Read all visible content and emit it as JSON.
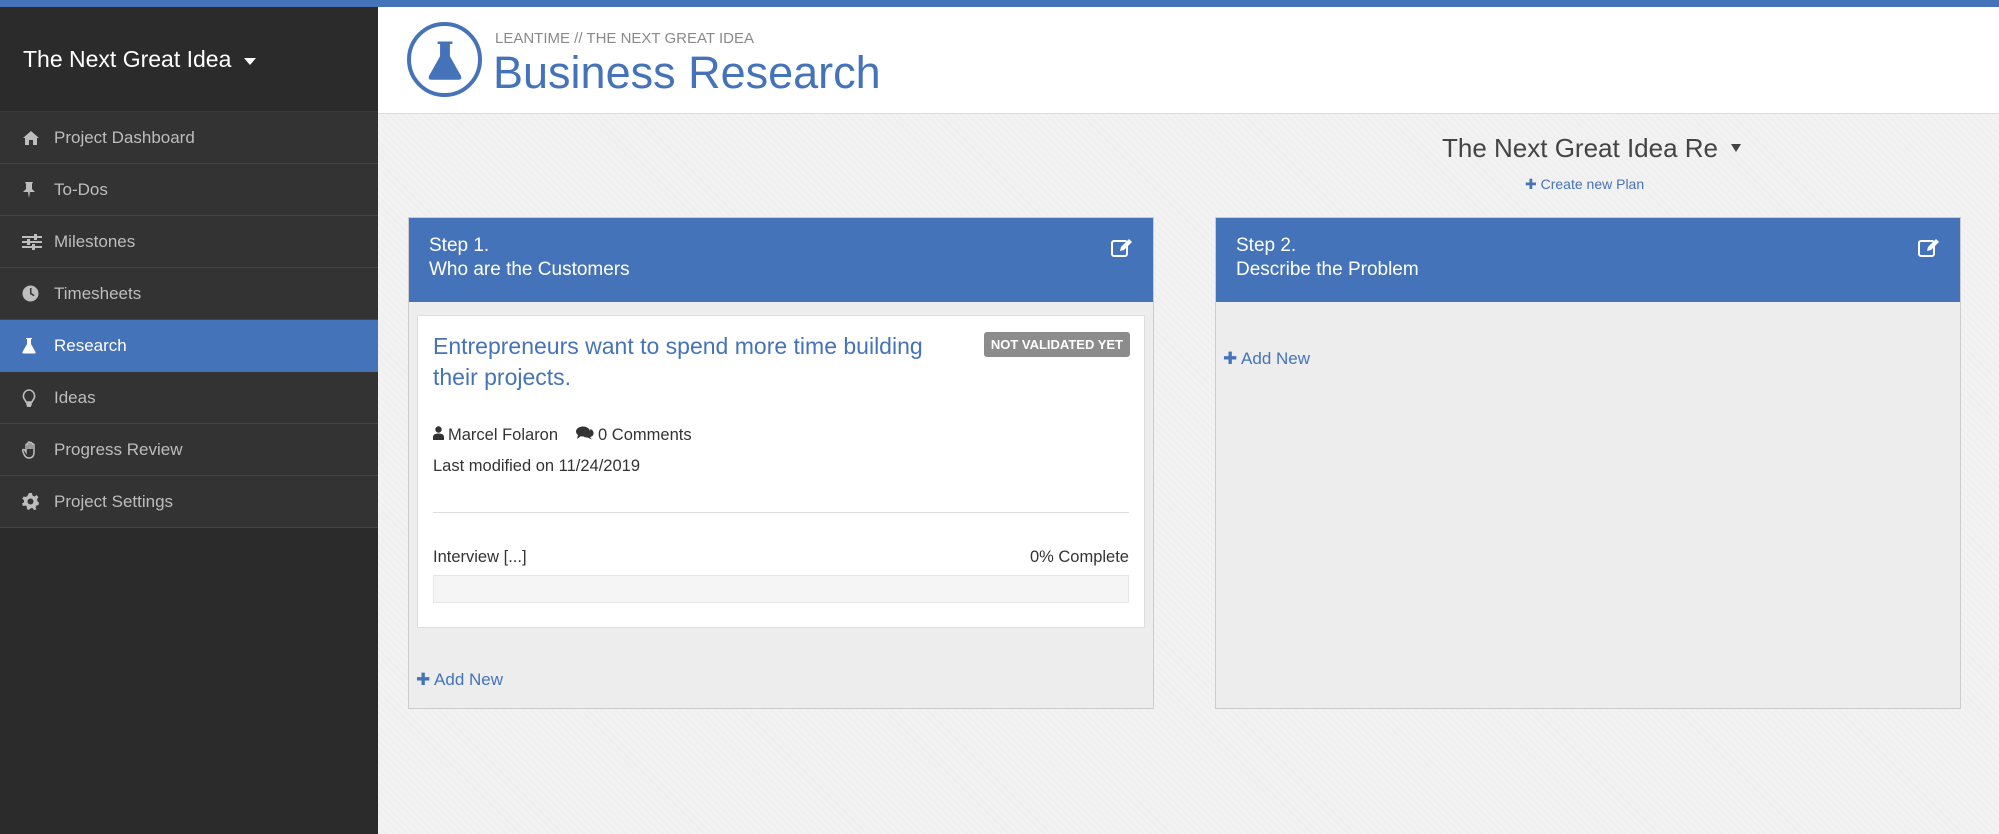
{
  "sidebar": {
    "project_name": "The Next Great Idea",
    "items": [
      {
        "label": "Project Dashboard",
        "icon": "home-icon"
      },
      {
        "label": "To-Dos",
        "icon": "pin-icon"
      },
      {
        "label": "Milestones",
        "icon": "sliders-icon"
      },
      {
        "label": "Timesheets",
        "icon": "clock-icon"
      },
      {
        "label": "Research",
        "icon": "flask-icon",
        "active": true
      },
      {
        "label": "Ideas",
        "icon": "lightbulb-icon"
      },
      {
        "label": "Progress Review",
        "icon": "hand-icon"
      },
      {
        "label": "Project Settings",
        "icon": "gear-icon"
      }
    ]
  },
  "header": {
    "breadcrumb": "LEANTIME // THE NEXT GREAT IDEA",
    "title": "Business Research",
    "icon": "flask-icon"
  },
  "plan": {
    "selected": "The Next Great Idea Re",
    "create_label": "Create new Plan"
  },
  "colors": {
    "accent": "#4573b9",
    "sidebar_bg": "#2b2b2b",
    "badge_bg": "#8c8c8c"
  },
  "steps": [
    {
      "title_line1": "Step 1.",
      "title_line2": "Who are the Customers",
      "add_label": "Add New",
      "card": {
        "title": "Entrepreneurs want to spend more time building their projects.",
        "status": "NOT VALIDATED YET",
        "author": "Marcel Folaron",
        "comments": "0 Comments",
        "modified": "Last modified on 11/24/2019",
        "metric": "Interview [...]",
        "progress_label": "0% Complete",
        "progress": 0
      }
    },
    {
      "title_line1": "Step 2.",
      "title_line2": "Describe the Problem",
      "add_label": "Add New"
    }
  ]
}
